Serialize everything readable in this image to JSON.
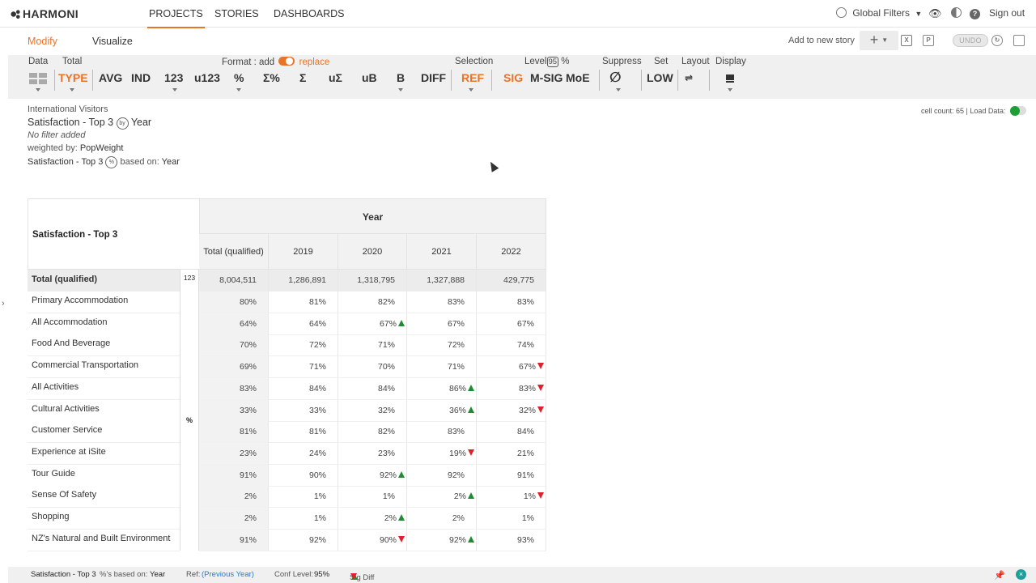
{
  "app": {
    "logo": "HARMONI"
  },
  "topnav": {
    "tabs": [
      {
        "label": "PROJECTS",
        "active": true
      },
      {
        "label": "STORIES",
        "active": false
      },
      {
        "label": "DASHBOARDS",
        "active": false
      }
    ],
    "global_filters": "Global Filters",
    "sign_out": "Sign out"
  },
  "subbar": {
    "modify": "Modify",
    "visualize": "Visualize",
    "add_to_story": "Add to new story",
    "undo": "UNDO"
  },
  "toolbar": {
    "labels": {
      "data": "Data",
      "total": "Total",
      "format": "Format : add",
      "replace": "replace",
      "selection": "Selection",
      "level": "Level",
      "level_value": "95",
      "level_pct": "%",
      "suppress": "Suppress",
      "set": "Set",
      "layout": "Layout",
      "display": "Display"
    },
    "buttons": {
      "type": "TYPE",
      "avg": "AVG",
      "ind": "IND",
      "n123": "123",
      "u123": "u123",
      "pct": "%",
      "sigma_pct": "Σ%",
      "sigma": "Σ",
      "u_sigma": "uΣ",
      "ub": "uB",
      "b": "B",
      "diff": "DIFF",
      "ref": "REF",
      "sig": "SIG",
      "msig": "M-SIG",
      "moe": "MoE",
      "suppress_icon": "∅",
      "low": "LOW"
    }
  },
  "meta": {
    "dataset": "International Visitors",
    "title_left": "Satisfaction - Top 3",
    "by_badge": "by",
    "title_right": "Year",
    "filter": "No filter added",
    "weighted_label": "weighted by:",
    "weighted_value": "PopWeight",
    "base_left": "Satisfaction - Top 3",
    "pct_badge": "%",
    "base_mid": "based on:",
    "base_value": "Year",
    "cell_count": "cell count: 65 | Load Data:"
  },
  "table": {
    "corner_title": "Satisfaction - Top 3",
    "year_header": "Year",
    "columns": [
      "Total (qualified)",
      "2019",
      "2020",
      "2021",
      "2022"
    ],
    "total_row": {
      "label": "Total (qualified)",
      "stat": "123",
      "values": [
        "8,004,511",
        "1,286,891",
        "1,318,795",
        "1,327,888",
        "429,775"
      ]
    },
    "stat_label": "%",
    "rows": [
      {
        "label": "Primary Accommodation",
        "values": [
          "80%",
          "81%",
          "82%",
          "83%",
          "83%"
        ],
        "sig": [
          "",
          "",
          "",
          "",
          ""
        ]
      },
      {
        "label": "All Accommodation",
        "values": [
          "64%",
          "64%",
          "67%",
          "67%",
          "67%"
        ],
        "sig": [
          "",
          "",
          "up",
          "",
          ""
        ]
      },
      {
        "label": "Food And Beverage",
        "values": [
          "70%",
          "72%",
          "71%",
          "72%",
          "74%"
        ],
        "sig": [
          "",
          "",
          "",
          "",
          ""
        ]
      },
      {
        "label": "Commercial Transportation",
        "values": [
          "69%",
          "71%",
          "70%",
          "71%",
          "67%"
        ],
        "sig": [
          "",
          "",
          "",
          "",
          "down"
        ]
      },
      {
        "label": "All Activities",
        "values": [
          "83%",
          "84%",
          "84%",
          "86%",
          "83%"
        ],
        "sig": [
          "",
          "",
          "",
          "up",
          "down"
        ]
      },
      {
        "label": "Cultural Activities",
        "values": [
          "33%",
          "33%",
          "32%",
          "36%",
          "32%"
        ],
        "sig": [
          "",
          "",
          "",
          "up",
          "down"
        ]
      },
      {
        "label": "Customer Service",
        "values": [
          "81%",
          "81%",
          "82%",
          "83%",
          "84%"
        ],
        "sig": [
          "",
          "",
          "",
          "",
          ""
        ]
      },
      {
        "label": "Experience at iSite",
        "values": [
          "23%",
          "24%",
          "23%",
          "19%",
          "21%"
        ],
        "sig": [
          "",
          "",
          "",
          "down",
          ""
        ]
      },
      {
        "label": "Tour Guide",
        "values": [
          "91%",
          "90%",
          "92%",
          "92%",
          "91%"
        ],
        "sig": [
          "",
          "",
          "up",
          "",
          ""
        ]
      },
      {
        "label": "Sense Of Safety",
        "values": [
          "2%",
          "1%",
          "1%",
          "2%",
          "1%"
        ],
        "sig": [
          "",
          "",
          "",
          "up",
          "down"
        ]
      },
      {
        "label": "Shopping",
        "values": [
          "2%",
          "1%",
          "2%",
          "2%",
          "1%"
        ],
        "sig": [
          "",
          "",
          "up",
          "",
          ""
        ]
      },
      {
        "label": "NZ's Natural and Built Environment",
        "values": [
          "91%",
          "92%",
          "90%",
          "92%",
          "93%"
        ],
        "sig": [
          "",
          "",
          "down",
          "up",
          ""
        ]
      }
    ]
  },
  "footer": {
    "title": "Satisfaction - Top 3",
    "pct_based": "%'s based on:",
    "based_value": "Year",
    "ref_label": "Ref:",
    "ref_value": "(Previous Year)",
    "conf_label": "Conf Level:",
    "conf_value": "95%",
    "sig_label": "Sig Diff"
  },
  "colors": {
    "accent": "#e8742a",
    "sig_up": "#1e8c32",
    "sig_down": "#e0202a",
    "link": "#2a7bd1"
  }
}
